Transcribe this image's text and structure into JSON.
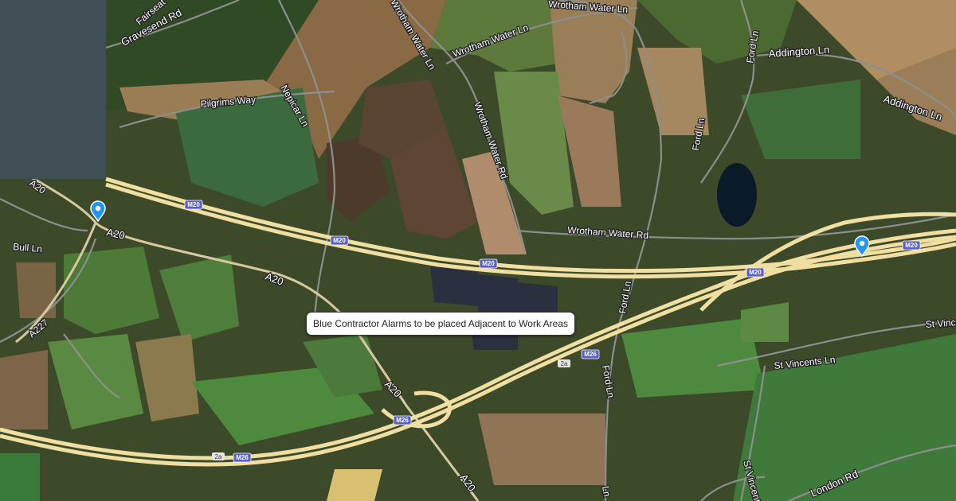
{
  "tooltip": {
    "text": "Blue Contractor Alarms to be placed Adjacent to Work Areas"
  },
  "roads": {
    "gravesend_rd": "Gravesend Rd",
    "fairseat": "Fairseat",
    "wrotham_water_ln_1": "Wrotham Water Ln",
    "wrotham_water_ln_2": "Wrotham Water Ln",
    "wrotham_water_ln_3": "Wrotham Water Ln",
    "wrotham_water_rd_v": "Wrotham Water Rd",
    "wrotham_water_rd_h": "Wrotham Water Rd",
    "addington_ln_1": "Addington Ln",
    "addington_ln_2": "Addington Ln",
    "pilgrims_way": "Pilgrims Way",
    "nepicar_ln": "Nepicar Ln",
    "ford_ln_1": "Ford Ln",
    "ford_ln_2": "Ford Ln",
    "ford_ln_3": "Ford Ln",
    "ford_ln_4": "Ford Ln",
    "bull_ln": "Bull Ln",
    "a227": "A227",
    "a20_1": "A20",
    "a20_2": "A20",
    "a20_3": "A20",
    "a20_4": "A20",
    "a20_5": "A20",
    "st_vincents_ln_1": "St Vincents Ln",
    "st_vincents_ln_2": "St Vincents",
    "st_vincents_ln_3": "St Vincents",
    "london_rd": "London Rd",
    "ln": "Ln"
  },
  "shields": {
    "m20_1": "M20",
    "m20_2": "M20",
    "m20_3": "M20",
    "m20_4": "M20",
    "m20_5": "M20",
    "m26_1": "M26",
    "m26_2": "M26",
    "m26_3": "M26"
  },
  "junctions": {
    "j1": "2a",
    "j2": "2a"
  },
  "markers": [
    {
      "name": "alarm-marker-west",
      "color": "#2196f3"
    },
    {
      "name": "alarm-marker-east",
      "color": "#2196f3"
    }
  ],
  "colors": {
    "motorway": "#f0dfa0",
    "panel": "#3f4f53",
    "shield": "#5b5fc7"
  }
}
